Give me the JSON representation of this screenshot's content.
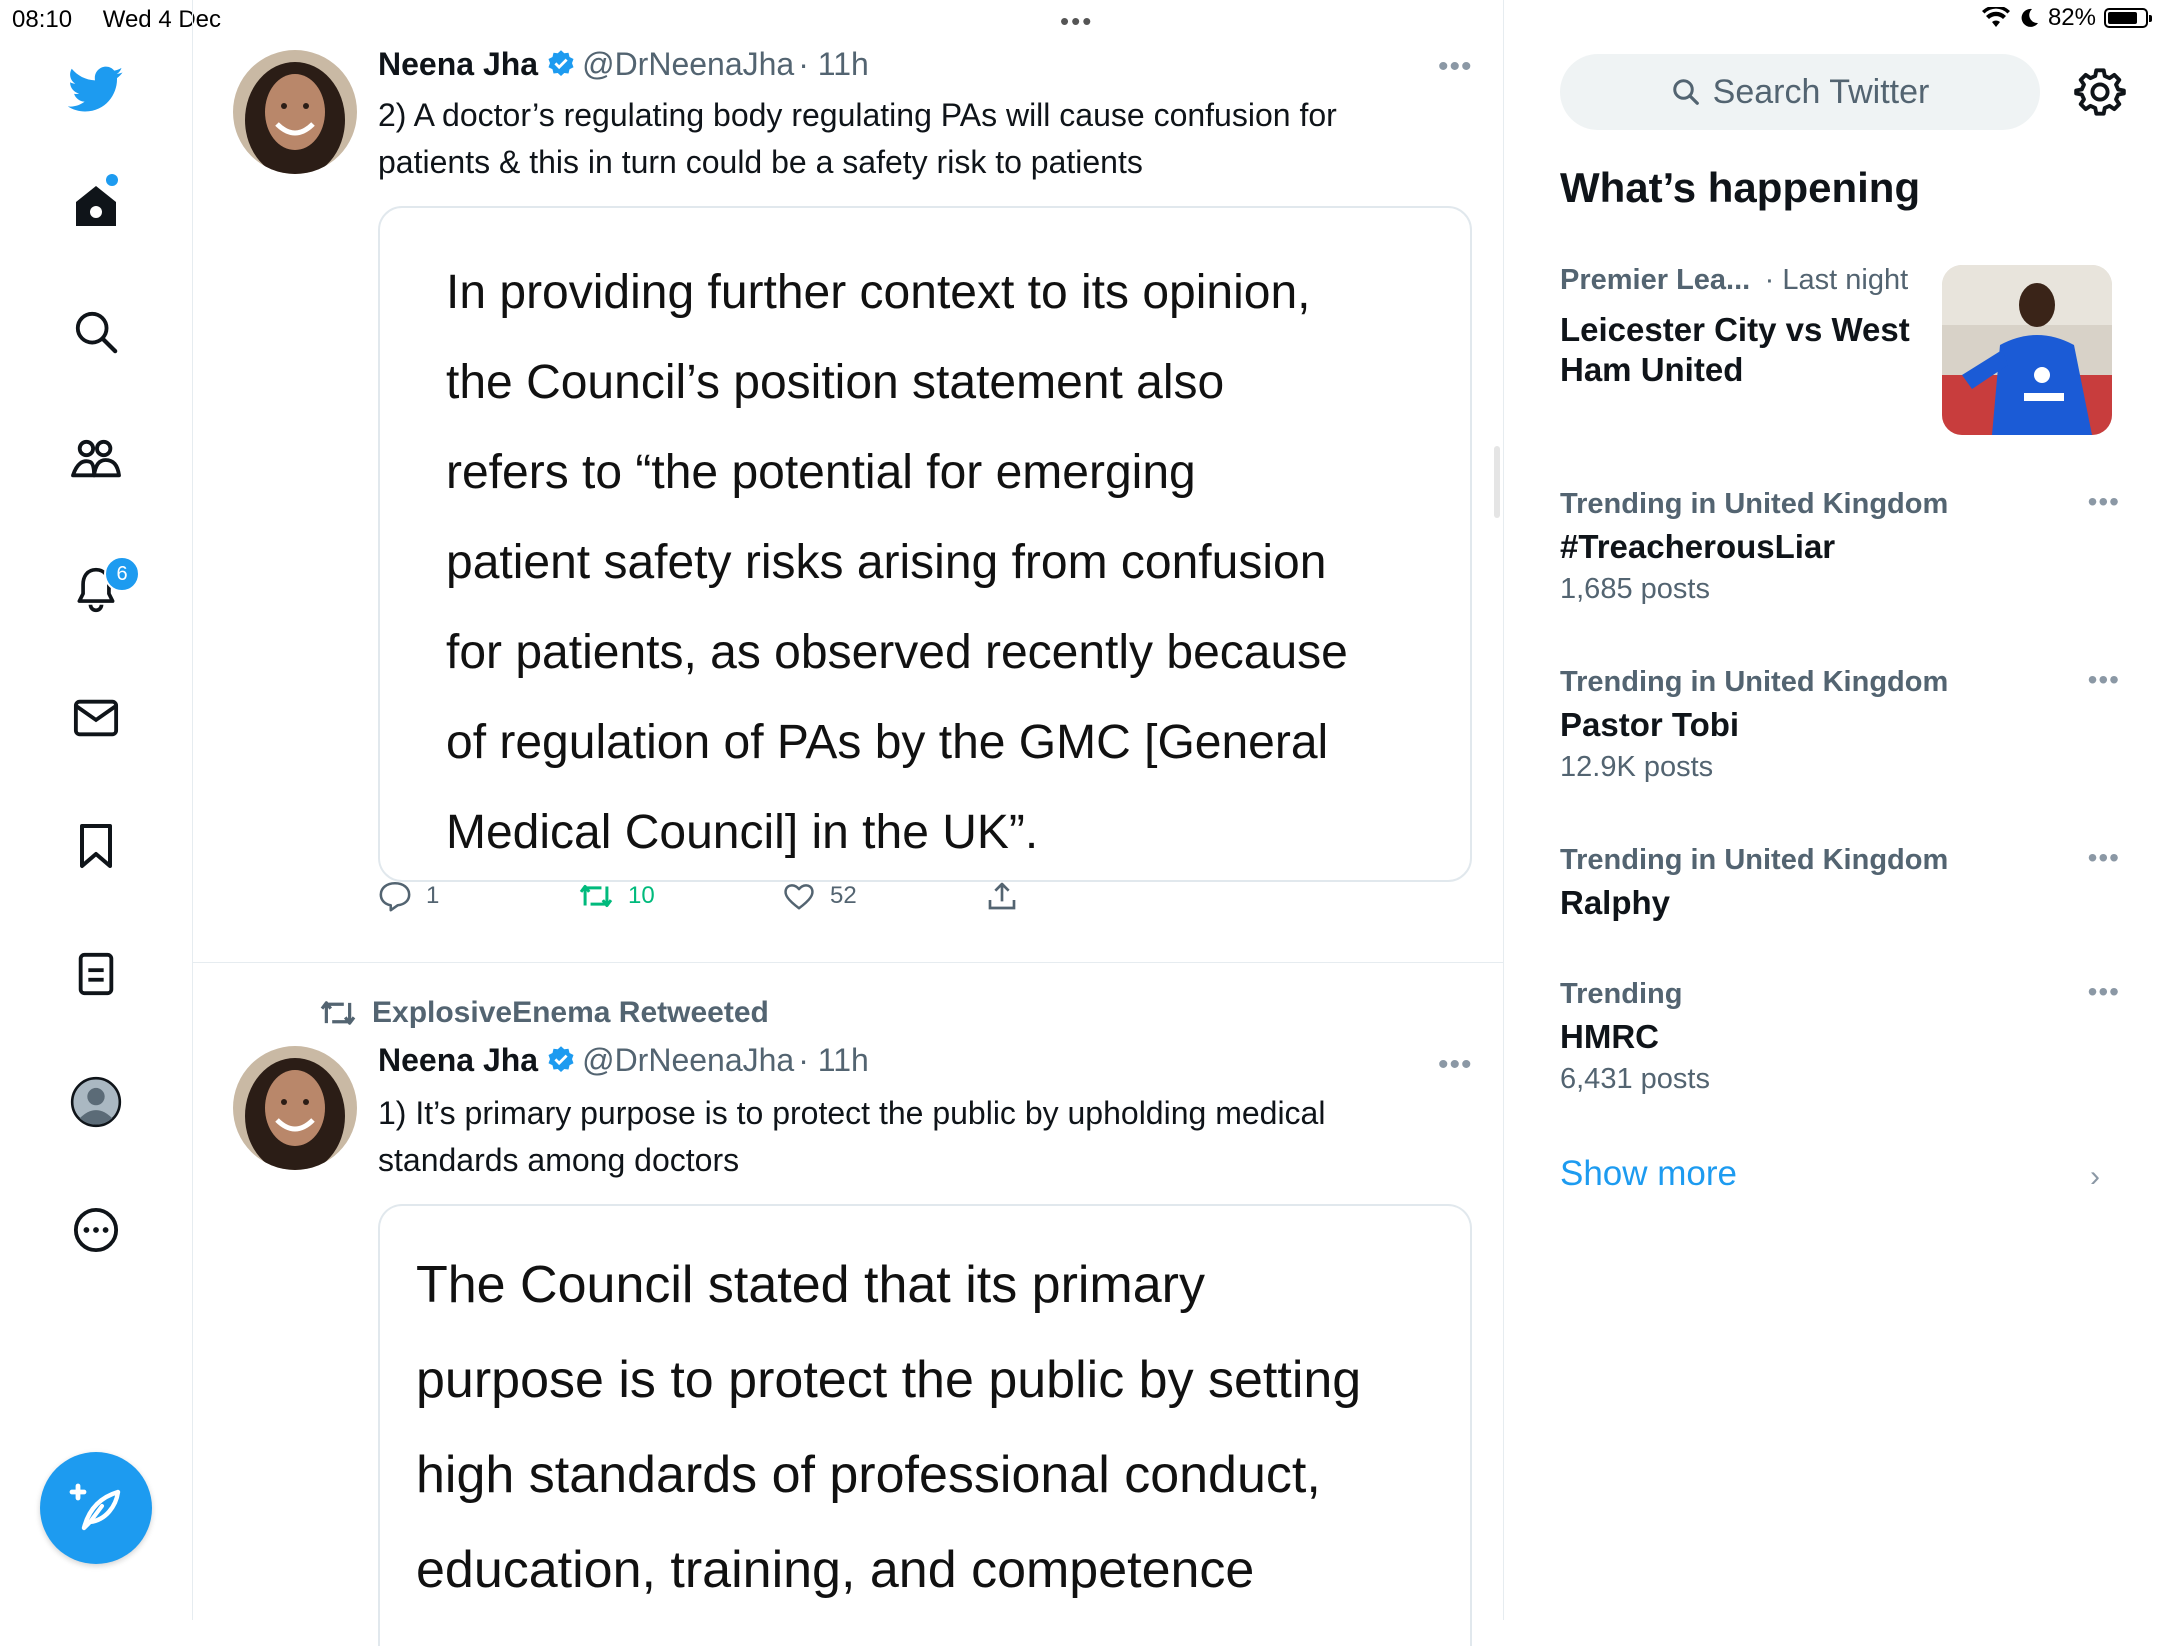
{
  "status": {
    "time": "08:10",
    "date": "Wed 4 Dec",
    "battery": "82%",
    "battery_level": 0.82
  },
  "nav": {
    "items": [
      {
        "name": "twitter-logo-icon"
      },
      {
        "name": "home-icon"
      },
      {
        "name": "explore-search-icon"
      },
      {
        "name": "communities-icon"
      },
      {
        "name": "notifications-bell-icon"
      },
      {
        "name": "messages-mail-icon"
      },
      {
        "name": "bookmarks-icon"
      },
      {
        "name": "lists-icon"
      },
      {
        "name": "profile-icon"
      },
      {
        "name": "more-circle-icon"
      }
    ],
    "notifications_badge": "6",
    "accent": "#1d9bf0"
  },
  "timeline": {
    "tweets": [
      {
        "name": "Neena Jha",
        "handle": "@DrNeenaJha",
        "time": "· 11h",
        "text_line1": "2) A doctor’s regulating body regulating PAs will cause confusion for",
        "text_line2": "patients & this in turn could be a safety risk to patients",
        "quote_lines": [
          "In providing further context to its opinion,",
          "the Council’s position statement also",
          "refers to “the potential for emerging",
          "patient safety risks arising from confusion",
          "for patients, as observed recently because",
          "of regulation of PAs by the GMC [General",
          "Medical Council] in the UK”."
        ],
        "replies": "1",
        "retweets": "10",
        "likes": "52"
      },
      {
        "retweeted_by": "ExplosiveEnema Retweeted",
        "name": "Neena Jha",
        "handle": "@DrNeenaJha",
        "time": "· 11h",
        "text_line1": "1) It’s primary purpose is to protect the public by upholding medical",
        "text_line2": "standards among doctors",
        "quote_lines": [
          "The Council stated that its primary",
          "purpose is to protect the public by setting",
          "high standards of professional conduct,",
          "education, training, and competence"
        ]
      }
    ]
  },
  "sidebar": {
    "search_placeholder": "Search Twitter",
    "section_title": "What’s happening",
    "featured": {
      "category": "Premier Lea...",
      "time": "· Last night",
      "title_line1": "Leicester City vs West",
      "title_line2": "Ham United"
    },
    "trends": [
      {
        "context": "Trending in United Kingdom",
        "title": "#TreacherousLiar",
        "count": "1,685 posts"
      },
      {
        "context": "Trending in United Kingdom",
        "title": "Pastor Tobi",
        "count": "12.9K posts"
      },
      {
        "context": "Trending in United Kingdom",
        "title": "Ralphy",
        "count": ""
      },
      {
        "context": "Trending",
        "title": "HMRC",
        "count": "6,431 posts"
      }
    ],
    "show_more": "Show more"
  }
}
